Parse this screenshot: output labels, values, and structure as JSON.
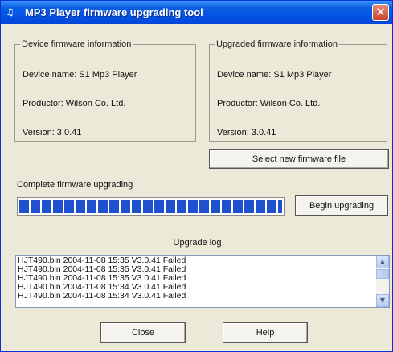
{
  "window": {
    "title": "MP3 Player firmware upgrading tool",
    "app_icon": "app-icon",
    "close_glyph": "✕"
  },
  "device_info": {
    "legend": "Device firmware information",
    "device_name": "Device name: S1 Mp3 Player",
    "productor": "Productor: Wilson Co. Ltd.",
    "version": "Version: 3.0.41"
  },
  "upgraded_info": {
    "legend": "Upgraded firmware information",
    "device_name": "Device name: S1 Mp3 Player",
    "productor": "Productor: Wilson Co. Ltd.",
    "version": "Version: 3.0.41"
  },
  "select_file_label": "Select new firmware file",
  "progress": {
    "label": "Complete firmware upgrading",
    "value": 1.0,
    "color": "#1f51cf"
  },
  "begin_label": "Begin upgrading",
  "log": {
    "title": "Upgrade log",
    "lines": [
      "HJT490.bin  2004-11-08  15:35  V3.0.41  Failed",
      "HJT490.bin  2004-11-08  15:35  V3.0.41  Failed",
      "HJT490.bin  2004-11-08  15:35  V3.0.41  Failed",
      "HJT490.bin  2004-11-08  15:34  V3.0.41  Failed",
      "HJT490.bin  2004-11-08  15:34  V3.0.41  Failed"
    ]
  },
  "buttons": {
    "close_label": "Close",
    "help_label": "Help"
  }
}
